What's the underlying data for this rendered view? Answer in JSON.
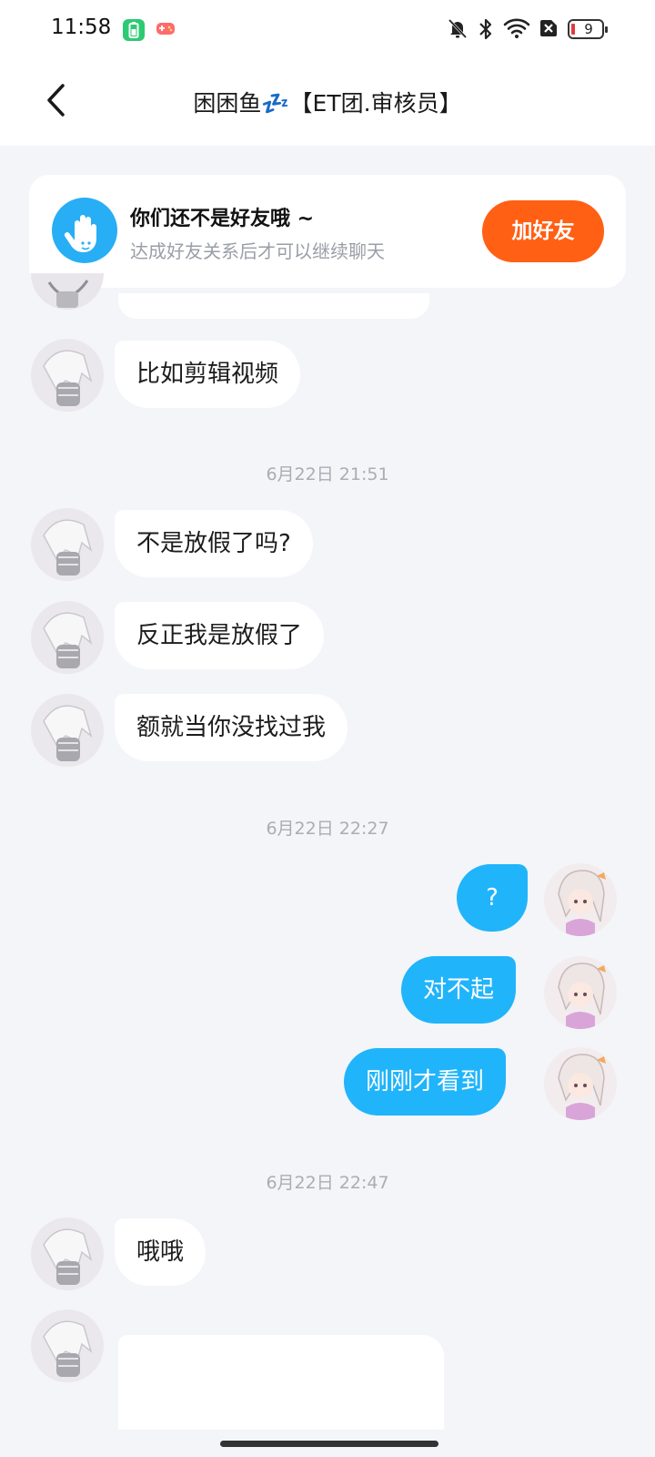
{
  "status_bar": {
    "time": "11:58",
    "battery": "9"
  },
  "header": {
    "title": "困困鱼💤【ET团.审核员】"
  },
  "friend_banner": {
    "title": "你们还不是好友哦 ~",
    "subtitle": "达成好友关系后才可以继续聊天",
    "button_label": "加好友",
    "accent": "#ff6014",
    "icon_color": "#27aef5"
  },
  "messages": {
    "m1": "比如剪辑视频",
    "t1": "6月22日 21:51",
    "m2": "不是放假了吗?",
    "m3": "反正我是放假了",
    "m4": "额就当你没找过我",
    "t2": "6月22日 22:27",
    "m5": "?",
    "m6": "对不起",
    "m7": "刚刚才看到",
    "t3": "6月22日 22:47",
    "m8": "哦哦"
  },
  "colors": {
    "outgoing_bubble": "#20b4fb",
    "incoming_bubble": "#ffffff",
    "background": "#f3f5f8"
  }
}
